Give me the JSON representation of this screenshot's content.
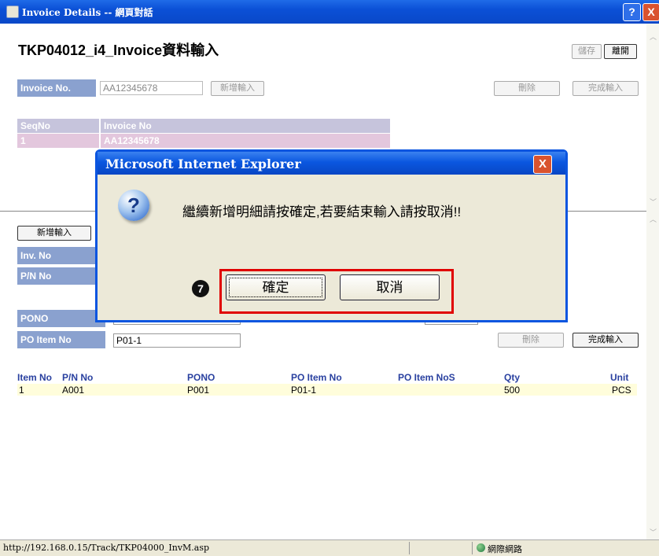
{
  "window": {
    "title": "Invoice Details -- 網頁對話",
    "help": "?",
    "close": "X"
  },
  "page": {
    "title": "TKP04012_i4_Invoice資料輸入",
    "save": "儲存",
    "leave": "離開"
  },
  "header_form": {
    "invoice_label": "Invoice No.",
    "invoice_value": "AA12345678",
    "new_entry": "新增輸入",
    "delete": "刪除",
    "complete": "完成輸入"
  },
  "seq_table": {
    "col_seq": "SeqNo",
    "col_invoice": "Invoice No",
    "row_seq": "1",
    "row_invoice": "AA12345678"
  },
  "detail_form": {
    "new_entry": "新增輸入",
    "inv_no_label": "Inv. No",
    "pn_no_label": "P/N No",
    "pono_label": "PONO",
    "po_item_label": "PO Item No",
    "po_item_value": "P01-1",
    "delete": "刪除",
    "complete": "完成輸入"
  },
  "items_table": {
    "headers": [
      "Item No",
      "P/N No",
      "PONO",
      "PO Item No",
      "PO Item NoS",
      "Qty",
      "Unit"
    ],
    "rows": [
      [
        "1",
        "A001",
        "P001",
        "P01-1",
        "",
        "500",
        "PCS"
      ]
    ]
  },
  "statusbar": {
    "url": "http://192.168.0.15/Track/TKP04000_InvM.asp",
    "zone": "網際網路"
  },
  "dialog": {
    "title": "Microsoft Internet Explorer",
    "close": "X",
    "icon": "?",
    "message": "繼續新增明細請按確定,若要結束輸入請按取消!!",
    "ok": "確定",
    "cancel": "取消",
    "step_marker": "7"
  },
  "colors": {
    "label_bg": "#8aa1cf",
    "dialog_border": "#0b55e0",
    "highlight": "#e00000"
  }
}
